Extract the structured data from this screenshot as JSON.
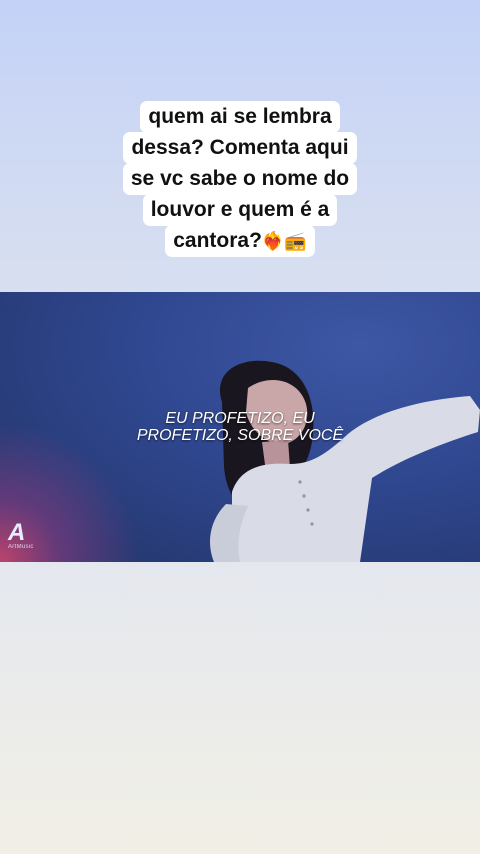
{
  "caption": {
    "lines": [
      "quem ai se lembra",
      "dessa? Comenta aqui",
      "se vc sabe o nome do",
      "louvor e quem é a",
      "cantora?"
    ],
    "emojis": "❤️‍🔥📻"
  },
  "video": {
    "lyric_line1": "EU PROFETIZO, EU",
    "lyric_line2": "PROFETIZO, SOBRE VOCÊ",
    "logo_mark": "A",
    "logo_text": "ArtMusic"
  }
}
